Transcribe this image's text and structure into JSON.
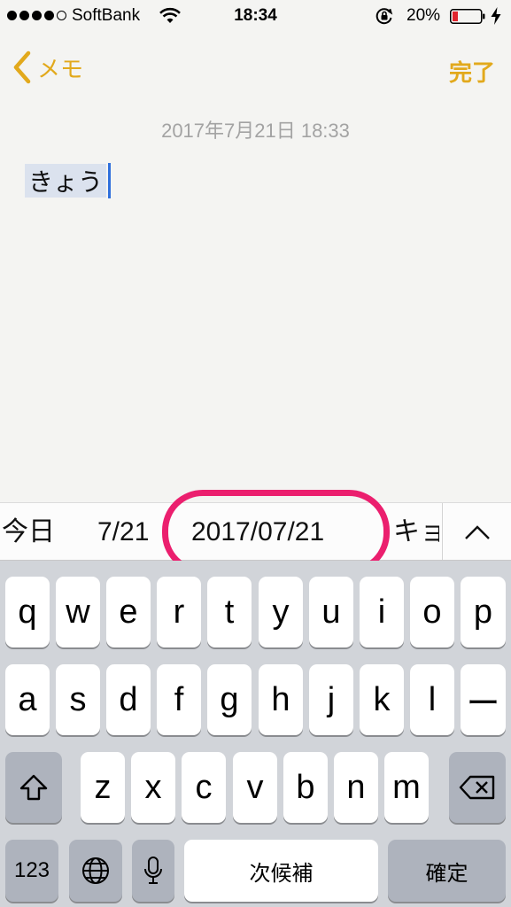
{
  "status_bar": {
    "carrier": "SoftBank",
    "time": "18:34",
    "battery_percent": "20%"
  },
  "nav": {
    "back_label": "メモ",
    "done_label": "完了",
    "accent": "#e2a91c"
  },
  "note": {
    "date": "2017年7月21日 18:33",
    "text": "きょう"
  },
  "suggestions": {
    "items": [
      "今日",
      "7/21",
      "2017/07/21",
      "キョ"
    ],
    "highlight_color": "#eb1f6e"
  },
  "keyboard": {
    "row1": [
      "q",
      "w",
      "e",
      "r",
      "t",
      "y",
      "u",
      "i",
      "o",
      "p"
    ],
    "row2": [
      "a",
      "s",
      "d",
      "f",
      "g",
      "h",
      "j",
      "k",
      "l",
      "ー"
    ],
    "row3": [
      "z",
      "x",
      "c",
      "v",
      "b",
      "n",
      "m"
    ],
    "numbers_label": "123",
    "space_label": "次候補",
    "return_label": "確定"
  }
}
